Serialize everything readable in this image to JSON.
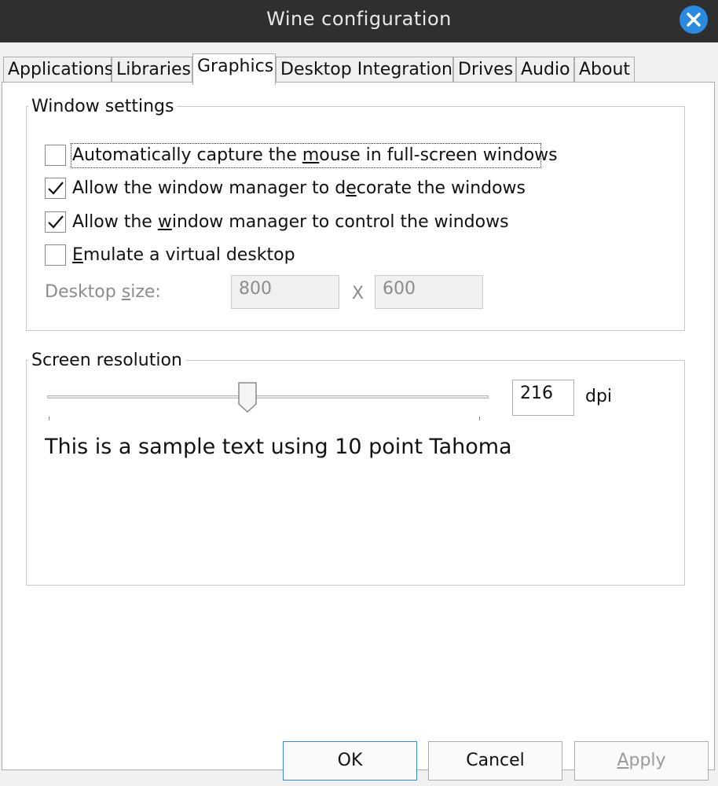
{
  "window": {
    "title": "Wine configuration"
  },
  "tabs": [
    "Applications",
    "Libraries",
    "Graphics",
    "Desktop Integration",
    "Drives",
    "Audio",
    "About"
  ],
  "active_tab": "Graphics",
  "window_settings": {
    "title": "Window settings",
    "options": [
      {
        "pre": "Automatically capture the ",
        "accel": "m",
        "post": "ouse in full-screen windows",
        "checked": false
      },
      {
        "pre": "Allow the window manager to d",
        "accel": "e",
        "post": "corate the windows",
        "checked": true
      },
      {
        "pre": "Allow the ",
        "accel": "w",
        "post": "indow manager to control the windows",
        "checked": true
      },
      {
        "pre": "",
        "accel": "E",
        "post": "mulate a virtual desktop",
        "checked": false
      }
    ],
    "desktop_size": {
      "label_pre": "Desktop ",
      "label_accel": "s",
      "label_post": "ize:",
      "width": "800",
      "separator": "X",
      "height": "600"
    }
  },
  "screen_resolution": {
    "title": "Screen resolution",
    "dpi_value": "216",
    "dpi_unit": "dpi",
    "sample_text": "This is a sample text using 10 point Tahoma"
  },
  "buttons": {
    "ok": "OK",
    "cancel": "Cancel",
    "apply_accel": "A",
    "apply_rest": "pply"
  },
  "colors": {
    "titlebar": "#2f2f2f",
    "close_button": "#2a8ae0",
    "default_button_border": "#3b86d6"
  }
}
